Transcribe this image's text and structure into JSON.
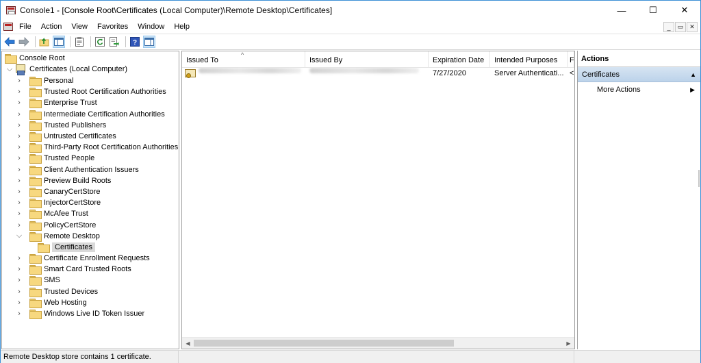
{
  "window": {
    "title": "Console1 - [Console Root\\Certificates (Local Computer)\\Remote Desktop\\Certificates]",
    "minimize_glyph": "—",
    "maximize_glyph": "☐",
    "close_glyph": "✕"
  },
  "menubar": {
    "items": [
      "File",
      "Action",
      "View",
      "Favorites",
      "Window",
      "Help"
    ]
  },
  "mdi": {
    "minimize": "_",
    "restore": "▭",
    "close": "✕"
  },
  "toolbar": {
    "icons": [
      "back-icon",
      "forward-icon",
      "up-folder-icon",
      "show-hide-tree-icon",
      "properties-icon",
      "refresh-icon",
      "export-list-icon",
      "help-icon",
      "action-pane-icon"
    ]
  },
  "tree": {
    "root": "Console Root",
    "computer": "Certificates (Local Computer)",
    "stores": [
      "Personal",
      "Trusted Root Certification Authorities",
      "Enterprise Trust",
      "Intermediate Certification Authorities",
      "Trusted Publishers",
      "Untrusted Certificates",
      "Third-Party Root Certification Authorities",
      "Trusted People",
      "Client Authentication Issuers",
      "Preview Build Roots",
      "CanaryCertStore",
      "InjectorCertStore",
      "McAfee Trust",
      "PolicyCertStore",
      "Remote Desktop"
    ],
    "selected_child": "Certificates",
    "stores_after": [
      "Certificate Enrollment Requests",
      "Smart Card Trusted Roots",
      "SMS",
      "Trusted Devices",
      "Web Hosting",
      "Windows Live ID Token Issuer"
    ]
  },
  "list": {
    "columns": [
      "Issued To",
      "Issued By",
      "Expiration Date",
      "Intended Purposes",
      "F"
    ],
    "rows": [
      {
        "expiration": "7/27/2020",
        "purposes": "Server Authenticati...",
        "friendly": "<"
      }
    ]
  },
  "actions": {
    "header": "Actions",
    "section": "Certificates",
    "items": [
      "More Actions"
    ]
  },
  "status": {
    "text": "Remote Desktop store contains 1 certificate."
  }
}
